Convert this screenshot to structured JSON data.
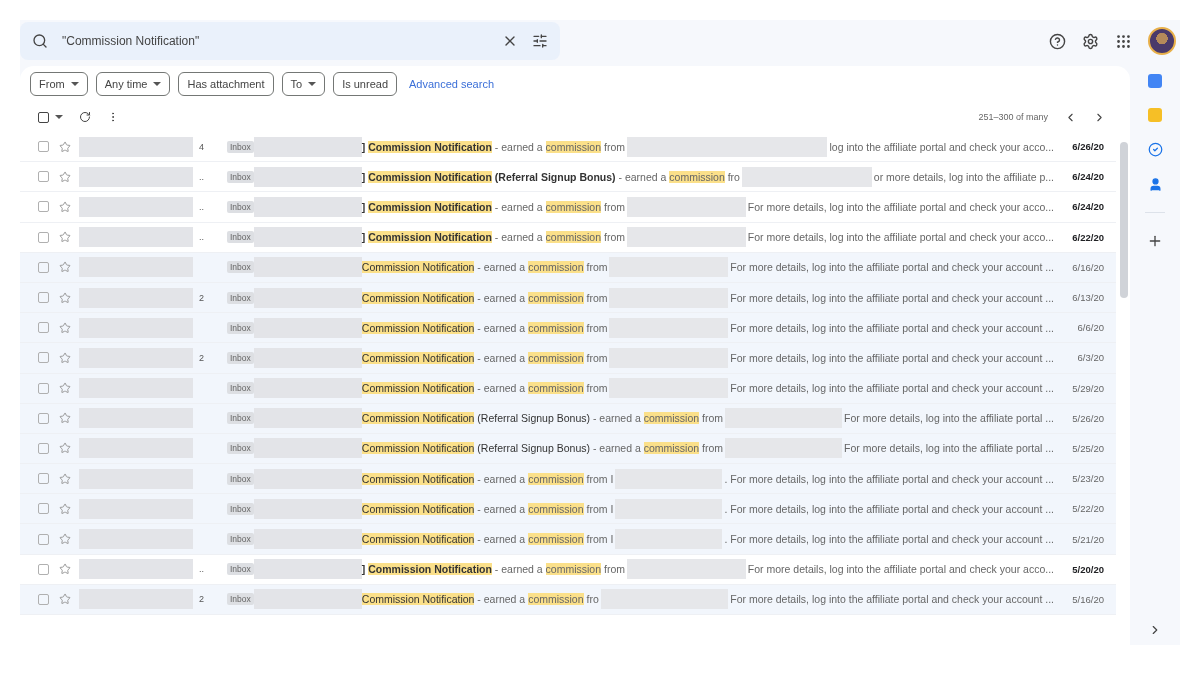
{
  "search": {
    "value": "\"Commission Notification\""
  },
  "filters": [
    {
      "label": "From",
      "dropdown": true
    },
    {
      "label": "Any time",
      "dropdown": true
    },
    {
      "label": "Has attachment",
      "dropdown": false
    },
    {
      "label": "To",
      "dropdown": true
    },
    {
      "label": "Is unread",
      "dropdown": false
    }
  ],
  "advanced_search": "Advanced search",
  "select_all": {
    "checked": false
  },
  "pagination": "251–300 of many",
  "rows": [
    {
      "unread": true,
      "count": "4",
      "label": "Inbox",
      "subject": [
        {
          "text": "] ",
          "highlight": false
        },
        {
          "text": "Commission Notification",
          "highlight": true
        }
      ],
      "preview": [
        {
          "text": " - earned a ",
          "highlight": false
        },
        {
          "text": "commission",
          "highlight": true
        },
        {
          "text": " from",
          "highlight": false
        }
      ],
      "snippet": "log into the affiliate portal and check your acco...",
      "date": "6/26/20"
    },
    {
      "unread": true,
      "count": "..",
      "label": "Inbox",
      "subject": [
        {
          "text": "] ",
          "highlight": false
        },
        {
          "text": "Commission Notification",
          "highlight": true
        },
        {
          "text": " (Referral Signup Bonus)",
          "highlight": false
        }
      ],
      "preview": [
        {
          "text": " - earned a ",
          "highlight": false
        },
        {
          "text": "commission",
          "highlight": true
        },
        {
          "text": " fro",
          "highlight": false
        }
      ],
      "snippet": "or more details, log into the affiliate p...",
      "date": "6/24/20"
    },
    {
      "unread": true,
      "count": "..",
      "label": "Inbox",
      "subject": [
        {
          "text": "] ",
          "highlight": false
        },
        {
          "text": "Commission Notification",
          "highlight": true
        }
      ],
      "preview": [
        {
          "text": " - earned a ",
          "highlight": false
        },
        {
          "text": "commission",
          "highlight": true
        },
        {
          "text": " from",
          "highlight": false
        }
      ],
      "snippet": "For more details, log into the affiliate portal and check your acco...",
      "date": "6/24/20"
    },
    {
      "unread": true,
      "count": "..",
      "label": "Inbox",
      "subject": [
        {
          "text": "] ",
          "highlight": false
        },
        {
          "text": "Commission Notification",
          "highlight": true
        }
      ],
      "preview": [
        {
          "text": " - earned a ",
          "highlight": false
        },
        {
          "text": "commission",
          "highlight": true
        },
        {
          "text": " from",
          "highlight": false
        }
      ],
      "snippet": "For more details, log into the affiliate portal and check your acco...",
      "date": "6/22/20"
    },
    {
      "unread": false,
      "label": "Inbox",
      "subject": [
        {
          "text": "Commission Notification",
          "highlight": true
        }
      ],
      "preview": [
        {
          "text": " - earned a ",
          "highlight": false
        },
        {
          "text": "commission",
          "highlight": true
        },
        {
          "text": " from",
          "highlight": false
        }
      ],
      "snippet": "For more details, log into the affiliate portal and check your account ...",
      "date": "6/16/20"
    },
    {
      "unread": false,
      "count": "2",
      "label": "Inbox",
      "subject": [
        {
          "text": "Commission Notification",
          "highlight": true
        }
      ],
      "preview": [
        {
          "text": " - earned a ",
          "highlight": false
        },
        {
          "text": "commission",
          "highlight": true
        },
        {
          "text": " from",
          "highlight": false
        }
      ],
      "snippet": "For more details, log into the affiliate portal and check your account ...",
      "date": "6/13/20"
    },
    {
      "unread": false,
      "label": "Inbox",
      "subject": [
        {
          "text": "Commission Notification",
          "highlight": true
        }
      ],
      "preview": [
        {
          "text": " - earned a ",
          "highlight": false
        },
        {
          "text": "commission",
          "highlight": true
        },
        {
          "text": " from",
          "highlight": false
        }
      ],
      "snippet": "For more details, log into the affiliate portal and check your account ...",
      "date": "6/6/20"
    },
    {
      "unread": false,
      "count": "2",
      "label": "Inbox",
      "subject": [
        {
          "text": "Commission Notification",
          "highlight": true
        }
      ],
      "preview": [
        {
          "text": " - earned a ",
          "highlight": false
        },
        {
          "text": "commission",
          "highlight": true
        },
        {
          "text": " from",
          "highlight": false
        }
      ],
      "snippet": "For more details, log into the affiliate portal and check your account ...",
      "date": "6/3/20"
    },
    {
      "unread": false,
      "label": "Inbox",
      "subject": [
        {
          "text": "Commission Notification",
          "highlight": true
        }
      ],
      "preview": [
        {
          "text": " - earned a ",
          "highlight": false
        },
        {
          "text": "commission",
          "highlight": true
        },
        {
          "text": " from",
          "highlight": false
        }
      ],
      "snippet": "For more details, log into the affiliate portal and check your account ...",
      "date": "5/29/20"
    },
    {
      "unread": false,
      "label": "Inbox",
      "subject": [
        {
          "text": "Commission Notification",
          "highlight": true
        },
        {
          "text": " (Referral Signup Bonus)",
          "highlight": false
        }
      ],
      "preview": [
        {
          "text": " - earned a ",
          "highlight": false
        },
        {
          "text": "commission",
          "highlight": true
        },
        {
          "text": " from",
          "highlight": false
        }
      ],
      "snippet": "For more details, log into the affiliate portal ...",
      "date": "5/26/20"
    },
    {
      "unread": false,
      "label": "Inbox",
      "subject": [
        {
          "text": "Commission Notification",
          "highlight": true
        },
        {
          "text": " (Referral Signup Bonus)",
          "highlight": false
        }
      ],
      "preview": [
        {
          "text": " - earned a ",
          "highlight": false
        },
        {
          "text": "commission",
          "highlight": true
        },
        {
          "text": " from",
          "highlight": false
        }
      ],
      "snippet": "For more details, log into the affiliate portal ...",
      "date": "5/25/20"
    },
    {
      "unread": false,
      "label": "Inbox",
      "subject": [
        {
          "text": "Commission Notification",
          "highlight": true
        }
      ],
      "preview": [
        {
          "text": " - earned a ",
          "highlight": false
        },
        {
          "text": "commission",
          "highlight": true
        },
        {
          "text": " from I",
          "highlight": false
        }
      ],
      "snippet": ". For more details, log into the affiliate portal and check your account ...",
      "date": "5/23/20"
    },
    {
      "unread": false,
      "label": "Inbox",
      "subject": [
        {
          "text": "Commission Notification",
          "highlight": true
        }
      ],
      "preview": [
        {
          "text": " - earned a ",
          "highlight": false
        },
        {
          "text": "commission",
          "highlight": true
        },
        {
          "text": " from I",
          "highlight": false
        }
      ],
      "snippet": ". For more details, log into the affiliate portal and check your account ...",
      "date": "5/22/20"
    },
    {
      "unread": false,
      "label": "Inbox",
      "subject": [
        {
          "text": "Commission Notification",
          "highlight": true
        }
      ],
      "preview": [
        {
          "text": " - earned a ",
          "highlight": false
        },
        {
          "text": "commission",
          "highlight": true
        },
        {
          "text": " from I",
          "highlight": false
        }
      ],
      "snippet": ". For more details, log into the affiliate portal and check your account ...",
      "date": "5/21/20"
    },
    {
      "unread": true,
      "count": "..",
      "label": "Inbox",
      "subject": [
        {
          "text": "] ",
          "highlight": false
        },
        {
          "text": "Commission Notification",
          "highlight": true
        }
      ],
      "preview": [
        {
          "text": " - earned a ",
          "highlight": false
        },
        {
          "text": "commission",
          "highlight": true
        },
        {
          "text": " from",
          "highlight": false
        }
      ],
      "snippet": "For more details, log into the affiliate portal and check your acco...",
      "date": "5/20/20"
    },
    {
      "unread": false,
      "count": "2",
      "label": "Inbox",
      "subject": [
        {
          "text": "Commission Notification",
          "highlight": true
        }
      ],
      "preview": [
        {
          "text": " - earned a ",
          "highlight": false
        },
        {
          "text": "commission",
          "highlight": true
        },
        {
          "text": " fro",
          "highlight": false
        }
      ],
      "snippet": "For more details, log into the affiliate portal and check your account ...",
      "date": "5/16/20"
    }
  ]
}
